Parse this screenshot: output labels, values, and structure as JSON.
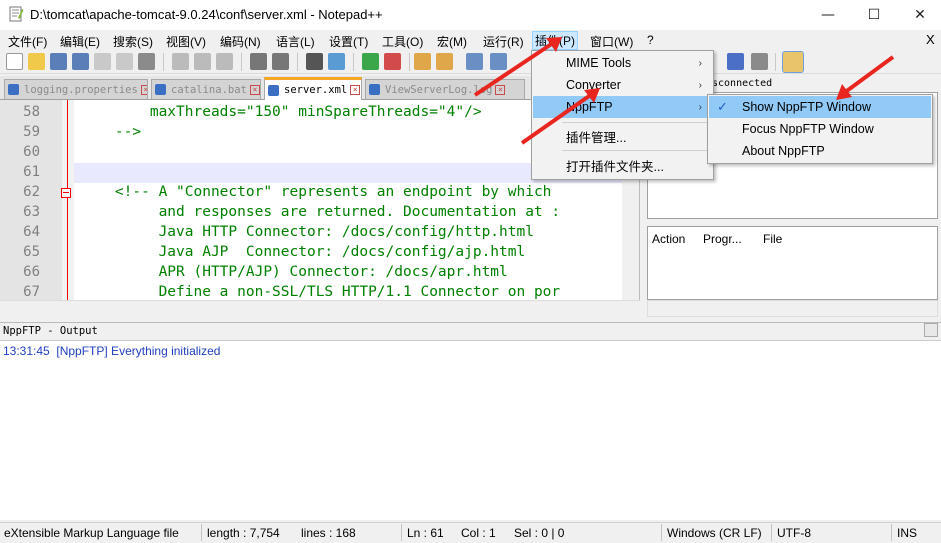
{
  "window": {
    "title": "D:\\tomcat\\apache-tomcat-9.0.24\\conf\\server.xml - Notepad++",
    "minimize": "—",
    "maximize": "☐",
    "close": "✕"
  },
  "menubar": {
    "items": [
      "文件(F)",
      "编辑(E)",
      "搜索(S)",
      "视图(V)",
      "编码(N)",
      "语言(L)",
      "设置(T)",
      "工具(O)",
      "宏(M)",
      "运行(R)",
      "插件(P)",
      "窗口(W)",
      "?"
    ],
    "close": "X"
  },
  "tabs": [
    {
      "label": "logging.properties",
      "active": false
    },
    {
      "label": "catalina.bat",
      "active": false
    },
    {
      "label": "server.xml",
      "active": true
    },
    {
      "label": "ViewServerLog.log",
      "active": false
    }
  ],
  "editor": {
    "lines": [
      {
        "num": "58",
        "text": "        maxThreads=\"150\" minSpareThreads=\"4\"/>"
      },
      {
        "num": "59",
        "text": "    -->"
      },
      {
        "num": "60",
        "text": ""
      },
      {
        "num": "61",
        "text": ""
      },
      {
        "num": "62",
        "text": "    <!-- A \"Connector\" represents an endpoint by which"
      },
      {
        "num": "63",
        "text": "         and responses are returned. Documentation at :"
      },
      {
        "num": "64",
        "text": "         Java HTTP Connector: /docs/config/http.html"
      },
      {
        "num": "65",
        "text": "         Java AJP  Connector: /docs/config/ajp.html"
      },
      {
        "num": "66",
        "text": "         APR (HTTP/AJP) Connector: /docs/apr.html"
      },
      {
        "num": "67",
        "text": "         Define a non-SSL/TLS HTTP/1.1 Connector on por"
      }
    ]
  },
  "plugins_menu": {
    "items": [
      {
        "label": "MIME Tools",
        "submenu": true
      },
      {
        "label": "Converter",
        "submenu": true
      },
      {
        "label": "NppFTP",
        "submenu": true,
        "highlighted": true
      },
      {
        "label": "插件管理...",
        "submenu": false
      },
      {
        "label": "打开插件文件夹...",
        "submenu": false
      }
    ]
  },
  "nppftp_submenu": {
    "items": [
      {
        "label": "Show NppFTP Window",
        "checked": true,
        "highlighted": true
      },
      {
        "label": "Focus NppFTP Window",
        "checked": false
      },
      {
        "label": "About NppFTP",
        "checked": false
      }
    ],
    "check_mark": "✓"
  },
  "ftp_panel": {
    "status": "sconnected",
    "columns": [
      "Action",
      "Progr...",
      "File"
    ]
  },
  "output": {
    "title": "NppFTP - Output",
    "lines": [
      "13:31:45  [NppFTP] Everything initialized"
    ]
  },
  "statusbar": {
    "file_type": "eXtensible Markup Language file",
    "length": "length : 7,754",
    "lines": "lines : 168",
    "ln": "Ln : 61",
    "col": "Col : 1",
    "sel": "Sel : 0 | 0",
    "eol": "Windows (CR LF)",
    "encoding": "UTF-8",
    "mode": "INS"
  },
  "colors": {
    "accent_highlight": "#91c9f7",
    "arrow": "#e8251f",
    "comment_green": "#008000",
    "fold_red": "#ff0000",
    "output_blue": "#1f3fbf"
  }
}
